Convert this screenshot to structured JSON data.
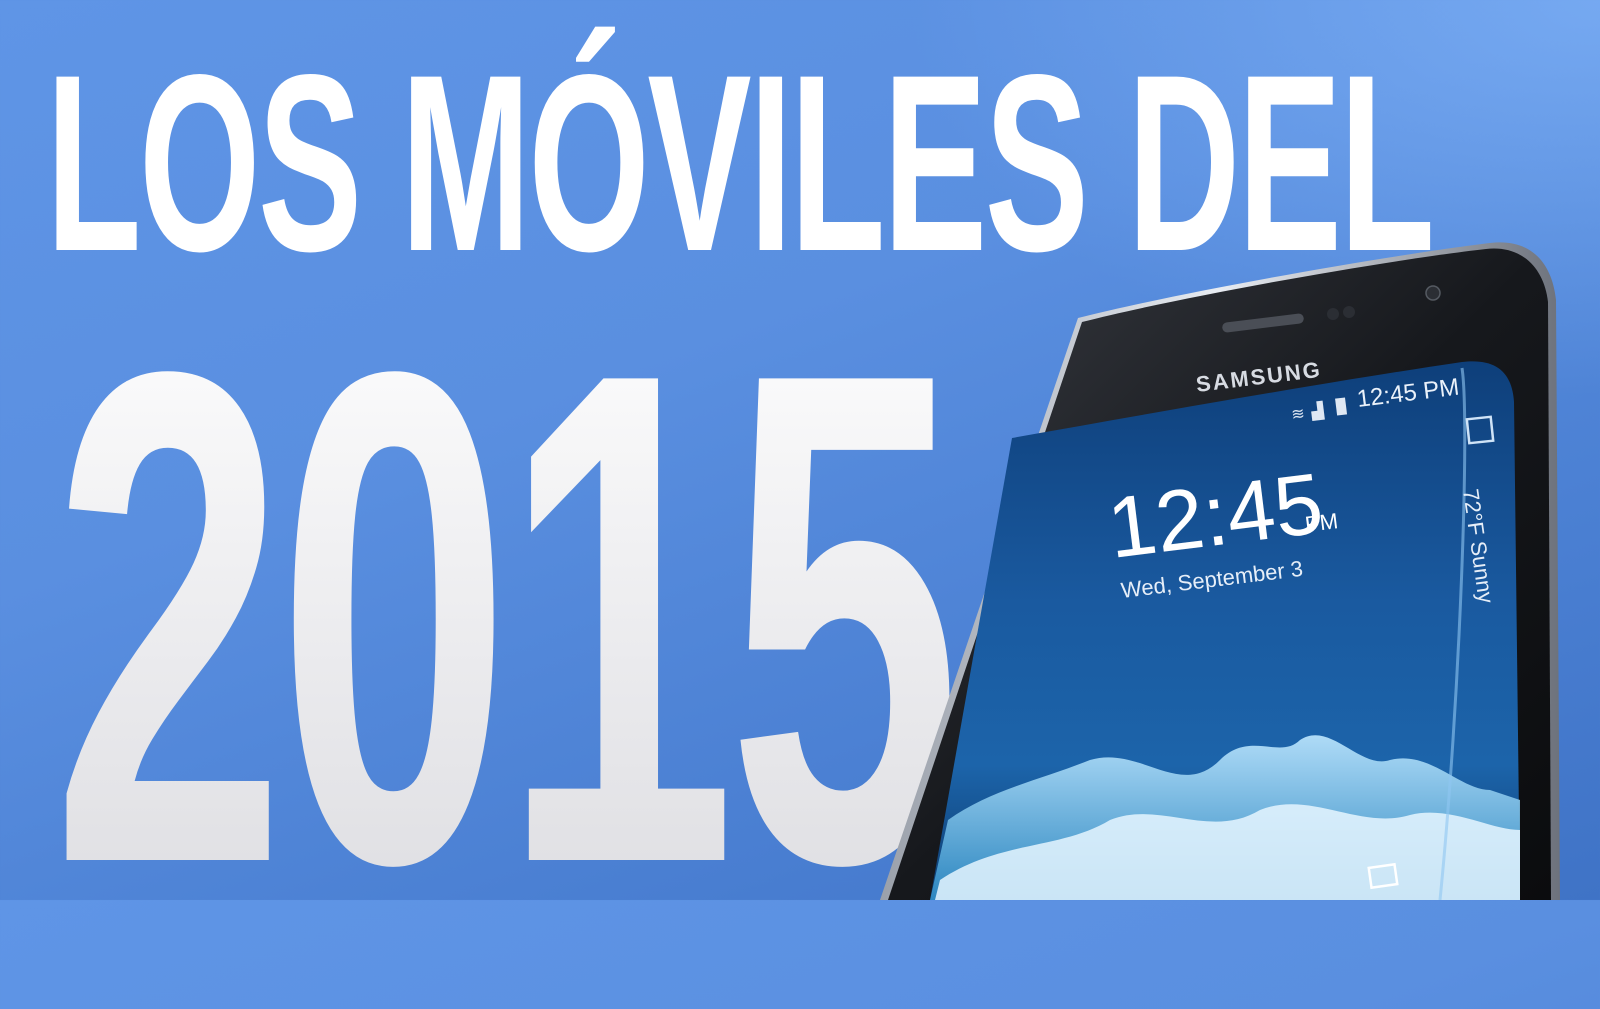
{
  "headline": "LOS MÓVILES DEL",
  "year": "2015",
  "phone": {
    "brand": "SAMSUNG",
    "status_time": "12:45 PM",
    "clock_time": "12:45",
    "clock_ampm": "PM",
    "date": "Wed, September 3",
    "edge_weather": "72°F  Sunny"
  },
  "colors": {
    "background": "#5a8fe0",
    "headline": "#ffffff",
    "screen": "#1a4f8f"
  }
}
